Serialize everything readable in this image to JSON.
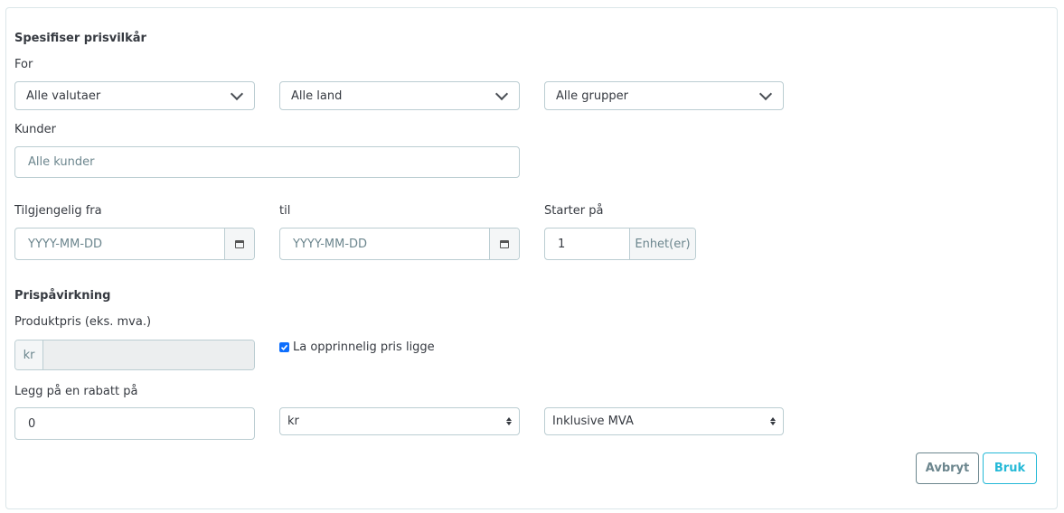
{
  "section1": {
    "heading": "Spesifiser prisvilkår",
    "for_label": "For",
    "currency_select": "Alle valutaer",
    "country_select": "Alle land",
    "group_select": "Alle grupper",
    "customers_label": "Kunder",
    "customers_placeholder": "Alle kunder",
    "from_label": "Tilgjengelig fra",
    "from_placeholder": "YYYY-MM-DD",
    "to_label": "til",
    "to_placeholder": "YYYY-MM-DD",
    "starts_label": "Starter på",
    "starts_value": "1",
    "starts_unit": "Enhet(er)"
  },
  "section2": {
    "heading": "Prispåvirkning",
    "product_price_label": "Produktpris (eks. mva.)",
    "currency_prefix": "kr",
    "keep_original_label": "La opprinnelig pris ligge",
    "keep_original_checked": true,
    "discount_label": "Legg på en rabatt på",
    "discount_value": "0",
    "discount_type": "kr",
    "tax_mode": "Inklusive MVA"
  },
  "actions": {
    "cancel": "Avbryt",
    "apply": "Bruk"
  },
  "colors": {
    "accent": "#25b9d7",
    "border": "#bbcdd2",
    "checkbox": "#0d6efd"
  }
}
